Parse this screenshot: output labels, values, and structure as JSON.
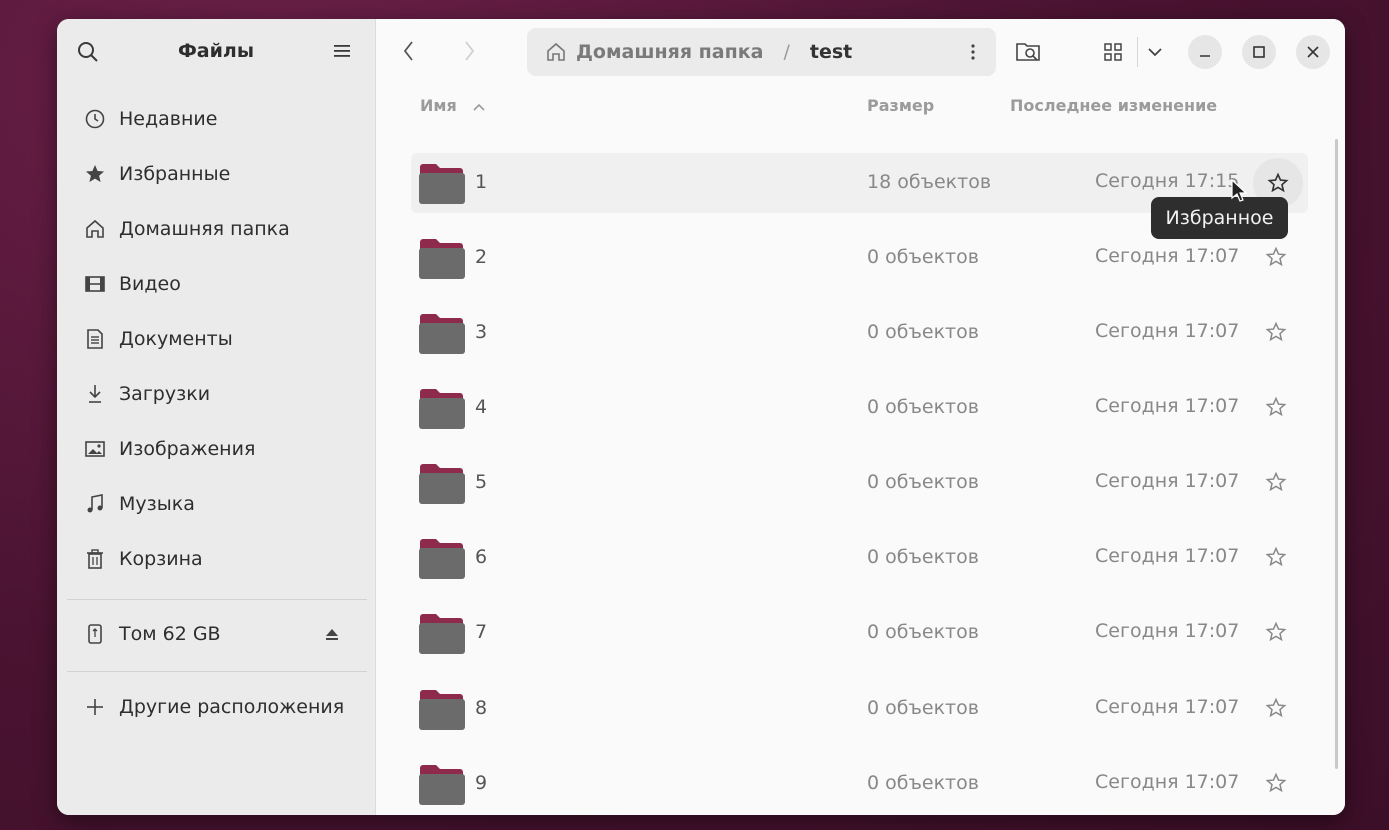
{
  "sidebar": {
    "title": "Файлы",
    "items": [
      {
        "label": "Недавние",
        "icon": "clock-icon"
      },
      {
        "label": "Избранные",
        "icon": "star-icon"
      },
      {
        "label": "Домашняя папка",
        "icon": "home-icon"
      },
      {
        "label": "Видео",
        "icon": "video-icon"
      },
      {
        "label": "Документы",
        "icon": "document-icon"
      },
      {
        "label": "Загрузки",
        "icon": "download-icon"
      },
      {
        "label": "Изображения",
        "icon": "image-icon"
      },
      {
        "label": "Музыка",
        "icon": "music-icon"
      },
      {
        "label": "Корзина",
        "icon": "trash-icon"
      }
    ],
    "volume": {
      "label": "Том 62 GB",
      "icon": "usb-drive-icon"
    },
    "other": {
      "label": "Другие расположения",
      "icon": "plus-icon"
    }
  },
  "path": {
    "home": "Домашняя папка",
    "separator": "/",
    "current": "test"
  },
  "columns": {
    "name": "Имя",
    "size": "Размер",
    "modified": "Последнее изменение"
  },
  "rows": [
    {
      "name": "1",
      "size": "18 объектов",
      "modified": "Сегодня 17:15"
    },
    {
      "name": "2",
      "size": "0 объектов",
      "modified": "Сегодня 17:07"
    },
    {
      "name": "3",
      "size": "0 объектов",
      "modified": "Сегодня 17:07"
    },
    {
      "name": "4",
      "size": "0 объектов",
      "modified": "Сегодня 17:07"
    },
    {
      "name": "5",
      "size": "0 объектов",
      "modified": "Сегодня 17:07"
    },
    {
      "name": "6",
      "size": "0 объектов",
      "modified": "Сегодня 17:07"
    },
    {
      "name": "7",
      "size": "0 объектов",
      "modified": "Сегодня 17:07"
    },
    {
      "name": "8",
      "size": "0 объектов",
      "modified": "Сегодня 17:07"
    },
    {
      "name": "9",
      "size": "0 объектов",
      "modified": "Сегодня 17:07"
    }
  ],
  "tooltip": "Избранное",
  "colors": {
    "folder_body": "#6b6b6b",
    "folder_tab": "#8e2a4c",
    "accent": "#e95420"
  }
}
